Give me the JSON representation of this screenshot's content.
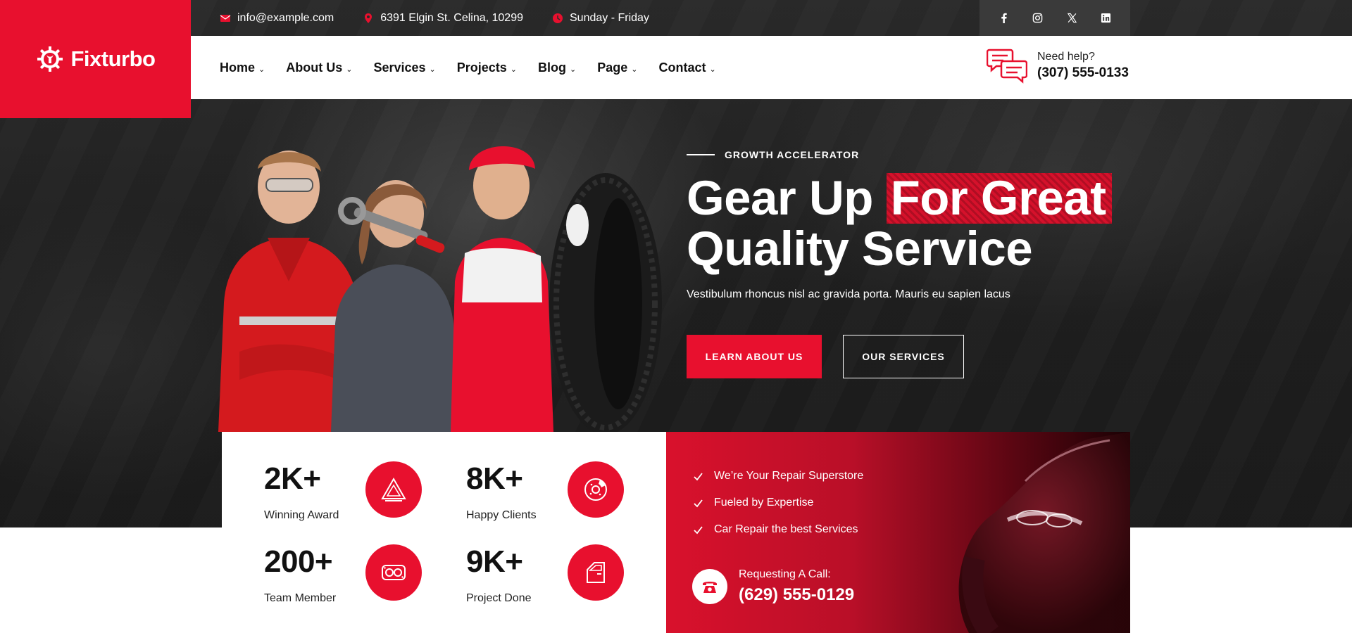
{
  "brand": {
    "name": "Fixturbo",
    "color": "#e8102e",
    "icon": "gear-wrench-icon"
  },
  "topbar": {
    "email": "info@example.com",
    "address": "6391 Elgin St. Celina, 10299",
    "hours": "Sunday - Friday",
    "social": [
      "facebook-icon",
      "instagram-icon",
      "x-icon",
      "linkedin-icon"
    ]
  },
  "nav": {
    "items": [
      {
        "label": "Home"
      },
      {
        "label": "About Us"
      },
      {
        "label": "Services"
      },
      {
        "label": "Projects"
      },
      {
        "label": "Blog"
      },
      {
        "label": "Page"
      },
      {
        "label": "Contact"
      }
    ],
    "help_label": "Need help?",
    "help_phone": "(307) 555-0133"
  },
  "hero": {
    "tag": "GROWTH ACCELERATOR",
    "title_part1": "Gear Up ",
    "title_highlight": "For Great",
    "title_part2": "Quality Service",
    "subtitle": "Vestibulum rhoncus nisl ac gravida porta. Mauris eu sapien lacus",
    "primary_button": "LEARN ABOUT US",
    "secondary_button": "OUR SERVICES"
  },
  "stats": [
    {
      "value": "2K+",
      "label": "Winning Award",
      "icon": "warning-triangle-icon"
    },
    {
      "value": "8K+",
      "label": "Happy Clients",
      "icon": "brake-disc-icon"
    },
    {
      "value": "200+",
      "label": "Team Member",
      "icon": "engine-gasket-icon"
    },
    {
      "value": "9K+",
      "label": "Project Done",
      "icon": "car-door-icon"
    }
  ],
  "features": {
    "items": [
      "We’re Your Repair Superstore",
      "Fueled by Expertise",
      "Car Repair the best Services"
    ],
    "call_label": "Requesting A Call:",
    "call_phone": "(629) 555-0129"
  }
}
